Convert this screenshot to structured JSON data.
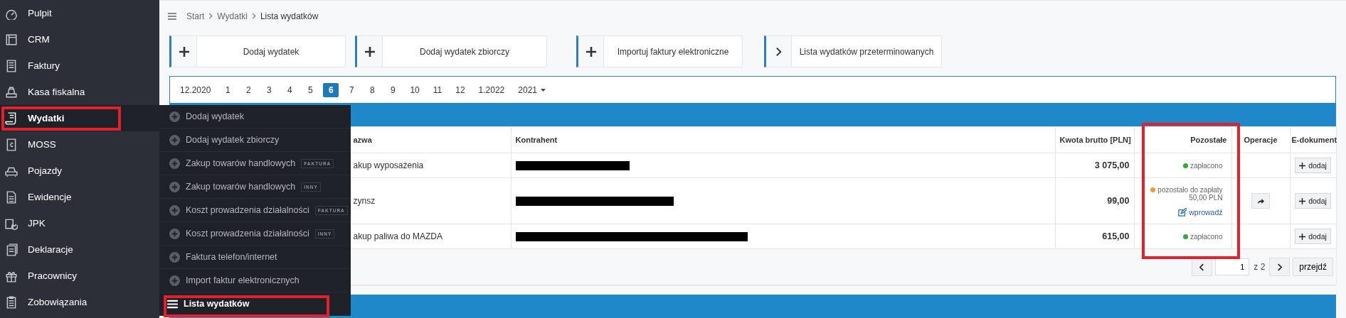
{
  "sidebar": {
    "items": [
      {
        "label": "Pulpit",
        "selected": false,
        "highlighted": false
      },
      {
        "label": "CRM",
        "selected": false,
        "highlighted": false
      },
      {
        "label": "Faktury",
        "selected": false,
        "highlighted": false
      },
      {
        "label": "Kasa fiskalna",
        "selected": false,
        "highlighted": false
      },
      {
        "label": "Wydatki",
        "selected": true,
        "highlighted": true
      },
      {
        "label": "MOSS",
        "selected": false,
        "highlighted": false
      },
      {
        "label": "Pojazdy",
        "selected": false,
        "highlighted": false
      },
      {
        "label": "Ewidencje",
        "selected": false,
        "highlighted": false
      },
      {
        "label": "JPK",
        "selected": false,
        "highlighted": false
      },
      {
        "label": "Deklaracje",
        "selected": false,
        "highlighted": false
      },
      {
        "label": "Pracownicy",
        "selected": false,
        "highlighted": false
      },
      {
        "label": "Zobowiązania",
        "selected": false,
        "highlighted": false
      }
    ]
  },
  "submenu": {
    "items": [
      {
        "kind": "add",
        "label": "Dodaj wydatek",
        "selected": false,
        "highlighted": false
      },
      {
        "kind": "add",
        "label": "Dodaj wydatek zbiorczy",
        "selected": false,
        "highlighted": false
      },
      {
        "kind": "add",
        "label": "Zakup towarów handlowych",
        "badge": "FAKTURA",
        "selected": false,
        "highlighted": false
      },
      {
        "kind": "add",
        "label": "Zakup towarów handlowych",
        "badge": "INNY",
        "selected": false,
        "highlighted": false
      },
      {
        "kind": "add",
        "label": "Koszt prowadzenia działalności",
        "badge": "FAKTURA",
        "selected": false,
        "highlighted": false
      },
      {
        "kind": "add",
        "label": "Koszt prowadzenia działalności",
        "badge": "INNY",
        "selected": false,
        "highlighted": false
      },
      {
        "kind": "add",
        "label": "Faktura telefon/internet",
        "selected": false,
        "highlighted": false
      },
      {
        "kind": "add",
        "label": "Import faktur elektronicznych",
        "selected": false,
        "highlighted": false
      },
      {
        "kind": "list",
        "label": "Lista wydatków",
        "selected": true,
        "highlighted": true
      }
    ]
  },
  "breadcrumb": [
    "Start",
    "Wydatki",
    "Lista wydatków"
  ],
  "actions": [
    {
      "kind": "add",
      "label": "Dodaj wydatek"
    },
    {
      "kind": "add",
      "label": "Dodaj wydatek zbiorczy"
    },
    {
      "kind": "add",
      "label": "Importuj faktury elektroniczne"
    },
    {
      "kind": "link",
      "label": "Lista wydatków przeterminowanych"
    }
  ],
  "months": [
    {
      "label": "12.2020",
      "selected": false
    },
    {
      "label": "1",
      "selected": false
    },
    {
      "label": "2",
      "selected": false
    },
    {
      "label": "3",
      "selected": false
    },
    {
      "label": "4",
      "selected": false
    },
    {
      "label": "5",
      "selected": false
    },
    {
      "label": "6",
      "selected": true
    },
    {
      "label": "7",
      "selected": false
    },
    {
      "label": "8",
      "selected": false
    },
    {
      "label": "9",
      "selected": false
    },
    {
      "label": "10",
      "selected": false
    },
    {
      "label": "11",
      "selected": false
    },
    {
      "label": "12",
      "selected": false
    },
    {
      "label": "1.2022",
      "selected": false
    }
  ],
  "year_dropdown": "2021",
  "table": {
    "columns": [
      {
        "label": "azwa",
        "highlighted": false
      },
      {
        "label": "Kontrahent",
        "highlighted": false
      },
      {
        "label": "Kwota brutto [PLN]",
        "highlighted": false
      },
      {
        "label": "Pozostałe",
        "highlighted": true
      },
      {
        "label": "Operacje",
        "highlighted": false
      },
      {
        "label": "E-dokument",
        "highlighted": false
      }
    ],
    "rows": [
      {
        "name": "akup wyposażenia",
        "contractor_redacted": true,
        "amount": "3 075,00",
        "remaining": {
          "kind": "paid",
          "color": "#33aa33",
          "text": "zapłacono"
        },
        "operation": false,
        "edoc": "dodaj"
      },
      {
        "name": "zynsz",
        "contractor_redacted": true,
        "amount": "99,00",
        "remaining": {
          "kind": "due",
          "color": "#f39a32",
          "text": "pozostało do zapłaty",
          "amount": "50,00 PLN",
          "link": "wprowadź"
        },
        "operation": true,
        "edoc": "dodaj"
      },
      {
        "name": "akup paliwa do MAZDA",
        "contractor_redacted": true,
        "amount": "615,00",
        "remaining": {
          "kind": "paid",
          "color": "#33aa33",
          "text": "zapłacono"
        },
        "operation": false,
        "edoc": "dodaj"
      }
    ]
  },
  "pagination": {
    "page": "1",
    "total": "z 2",
    "go": "przejdź"
  }
}
